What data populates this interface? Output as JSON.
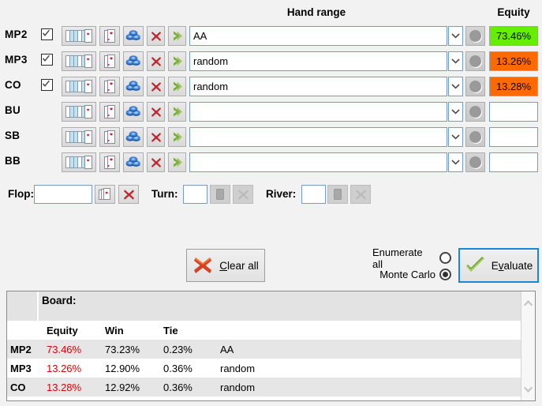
{
  "header": {
    "hand_range_label": "Hand range",
    "equity_label": "Equity"
  },
  "players": [
    {
      "position": "MP2",
      "checked": true,
      "range": "AA",
      "equity": "73.46%",
      "equity_color": "#66ee00"
    },
    {
      "position": "MP3",
      "checked": true,
      "range": "random",
      "equity": "13.26%",
      "equity_color": "#ff6a00"
    },
    {
      "position": "CO",
      "checked": true,
      "range": "random",
      "equity": "13.28%",
      "equity_color": "#ff6a00"
    },
    {
      "position": "BU",
      "checked": false,
      "range": "",
      "equity": "",
      "equity_color": ""
    },
    {
      "position": "SB",
      "checked": false,
      "range": "",
      "equity": "",
      "equity_color": ""
    },
    {
      "position": "BB",
      "checked": false,
      "range": "",
      "equity": "",
      "equity_color": ""
    }
  ],
  "board": {
    "flop_label": "Flop:",
    "flop_value": "",
    "turn_label": "Turn:",
    "turn_value": "",
    "river_label": "River:",
    "river_value": ""
  },
  "actions": {
    "clear_all_label": "Clear all",
    "clear_all_mnemonic": "C",
    "evaluate_label": "Evaluate",
    "evaluate_mnemonic": "v",
    "enumerate_all_label": "Enumerate all",
    "monte_carlo_label": "Monte Carlo",
    "mode_selected": "Monte Carlo"
  },
  "results": {
    "board_label": "Board:",
    "board_value": "",
    "columns": [
      "",
      "Equity",
      "Win",
      "Tie",
      ""
    ],
    "rows": [
      {
        "position": "MP2",
        "equity": "73.46%",
        "win": "73.23%",
        "tie": "0.23%",
        "range": "AA"
      },
      {
        "position": "MP3",
        "equity": "13.26%",
        "win": "12.90%",
        "tie": "0.36%",
        "range": "random"
      },
      {
        "position": "CO",
        "equity": "13.28%",
        "win": "12.92%",
        "tie": "0.36%",
        "range": "random"
      }
    ]
  },
  "colors": {
    "equity_high": "#66ee00",
    "equity_low": "#ff6a00",
    "result_equity_text": "#e10000",
    "focus_border": "#1b85d6"
  }
}
